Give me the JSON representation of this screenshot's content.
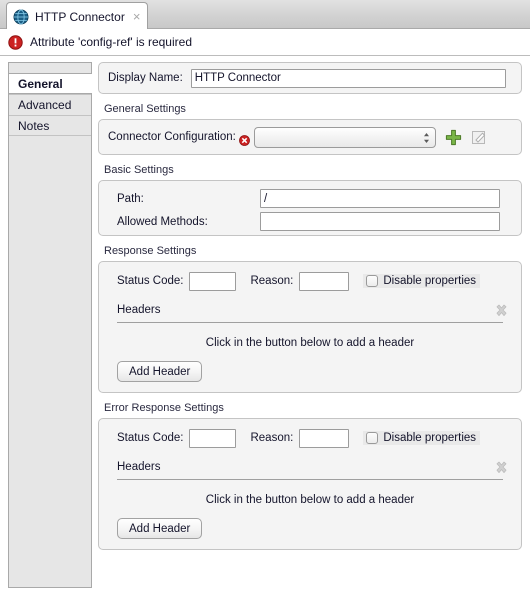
{
  "tab": {
    "title": "HTTP Connector",
    "icon": "globe-icon",
    "close_label": "×"
  },
  "error_banner": {
    "icon": "error-icon",
    "message": "Attribute 'config-ref' is required"
  },
  "sidebar": {
    "items": [
      {
        "label": "General",
        "selected": true
      },
      {
        "label": "Advanced",
        "selected": false
      },
      {
        "label": "Notes",
        "selected": false
      }
    ]
  },
  "display_name": {
    "label": "Display Name:",
    "value": "HTTP Connector",
    "placeholder": ""
  },
  "general_settings": {
    "group_label": "General Settings",
    "connector_config_label": "Connector Configuration:",
    "connector_config_value": "",
    "error_marker": "required-error-icon",
    "add_label": "add-config-button",
    "edit_label": "edit-config-button"
  },
  "basic_settings": {
    "group_label": "Basic Settings",
    "path_label": "Path:",
    "path_value": "/",
    "allowed_methods_label": "Allowed Methods:",
    "allowed_methods_value": ""
  },
  "response_settings": {
    "group_label": "Response Settings",
    "status_code_label": "Status Code:",
    "status_code_value": "",
    "reason_label": "Reason:",
    "reason_value": "",
    "disable_properties_label": "Disable properties",
    "disable_properties_checked": false,
    "headers_label": "Headers",
    "hint": "Click in the button below to add a header",
    "add_header_label": "Add Header",
    "delete_icon": "delete-header-icon"
  },
  "error_response_settings": {
    "group_label": "Error Response Settings",
    "status_code_label": "Status Code:",
    "status_code_value": "",
    "reason_label": "Reason:",
    "reason_value": "",
    "disable_properties_label": "Disable properties",
    "disable_properties_checked": false,
    "headers_label": "Headers",
    "hint": "Click in the button below to add a header",
    "add_header_label": "Add Header",
    "delete_icon": "delete-header-icon"
  },
  "colors": {
    "error_red": "#cc2222",
    "accent_green": "#7ab648",
    "tab_active_bg": "#ffffff",
    "panel_bg": "#f4f4f4",
    "sidebar_bg": "#e6e6e6"
  }
}
